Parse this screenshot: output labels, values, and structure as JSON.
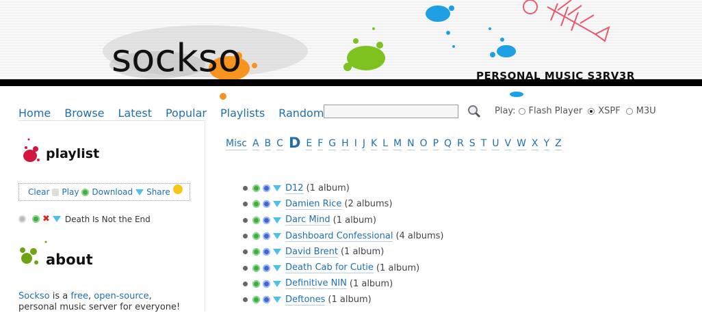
{
  "header": {
    "logo": "sockso",
    "tagline": "PERSONAL MUSIC S3RV3R"
  },
  "nav": [
    "Home",
    "Browse",
    "Latest",
    "Popular",
    "Playlists",
    "Random"
  ],
  "search": {
    "value": "",
    "placeholder": ""
  },
  "play": {
    "label": "Play:",
    "options": [
      {
        "label": "Flash Player",
        "selected": false
      },
      {
        "label": "XSPF",
        "selected": true
      },
      {
        "label": "M3U",
        "selected": false
      }
    ]
  },
  "sidebar": {
    "playlist_title": "playlist",
    "playlist_actions": {
      "clear": "Clear",
      "play": "Play",
      "download": "Download",
      "share": "Share"
    },
    "playlist_items": [
      "Death Is Not the End"
    ],
    "about_title": "about",
    "about": {
      "pre": "Sockso",
      "mid1": " is a ",
      "link1": "free",
      "mid2": ", ",
      "link2": "open-source",
      "post": ",",
      "line2": "personal music server for everyone!"
    }
  },
  "alphabet": {
    "letters": [
      "Misc",
      "A",
      "B",
      "C",
      "D",
      "E",
      "F",
      "G",
      "H",
      "I",
      "J",
      "K",
      "L",
      "M",
      "N",
      "O",
      "P",
      "Q",
      "R",
      "S",
      "T",
      "U",
      "V",
      "W",
      "X",
      "Y",
      "Z"
    ],
    "current": "D"
  },
  "artists": [
    {
      "name": "D12",
      "count": "(1 album)"
    },
    {
      "name": "Damien Rice",
      "count": "(2 albums)"
    },
    {
      "name": "Darc Mind",
      "count": "(1 album)"
    },
    {
      "name": "Dashboard Confessional",
      "count": "(4 albums)"
    },
    {
      "name": "David Brent",
      "count": "(1 album)"
    },
    {
      "name": "Death Cab for Cutie",
      "count": "(1 album)"
    },
    {
      "name": "Definitive NIN",
      "count": "(1 album)"
    },
    {
      "name": "Deftones",
      "count": "(1 album)"
    }
  ],
  "colors": {
    "link": "#1f6fb0",
    "splash_orange": "#f7931e",
    "splash_green": "#7dc21e",
    "splash_blue": "#1ea0e6",
    "splash_red": "#e8304a"
  }
}
